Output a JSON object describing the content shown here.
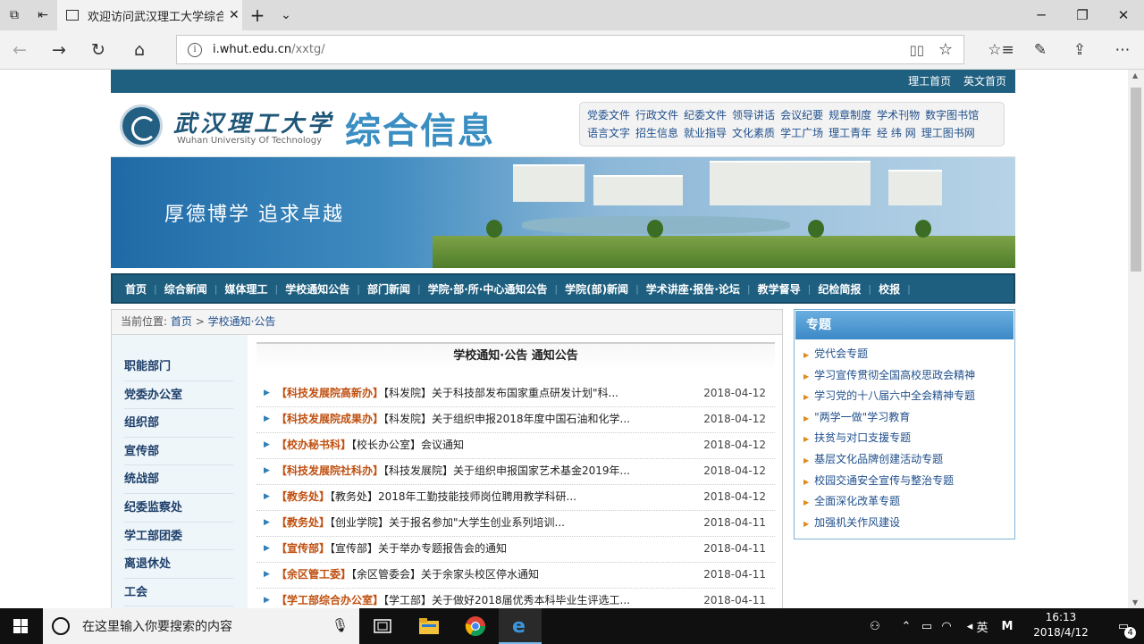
{
  "browser": {
    "tab_title": "欢迎访问武汉理工大学综合信息",
    "url_host": "i.whut.edu.cn",
    "url_path": "/xxtg/"
  },
  "site": {
    "top_links": [
      "理工首页",
      "英文首页"
    ],
    "logo_cn": "武汉理工大学",
    "logo_en": "Wuhan University Of Technology",
    "logo_title": "综合信息",
    "quick_links": [
      "党委文件",
      "行政文件",
      "纪委文件",
      "领导讲话",
      "会议纪要",
      "规章制度",
      "学术刊物",
      "数字图书馆",
      "语言文字",
      "招生信息",
      "就业指导",
      "文化素质",
      "学工广场",
      "理工青年",
      "经 纬 网",
      "理工图书网"
    ],
    "banner_slogan": "厚德博学  追求卓越",
    "nav": [
      "首页",
      "综合新闻",
      "媒体理工",
      "学校通知公告",
      "部门新闻",
      "学院·部·所·中心通知公告",
      "学院(部)新闻",
      "学术讲座·报告·论坛",
      "教学督导",
      "纪检简报",
      "校报"
    ],
    "breadcrumb_prefix": "当前位置:",
    "breadcrumb_home": "首页",
    "breadcrumb_sep": ">",
    "breadcrumb_current": "学校通知·公告",
    "side_nav": [
      "职能部门",
      "党委办公室",
      "组织部",
      "宣传部",
      "统战部",
      "纪委监察处",
      "学工部团委",
      "离退休处",
      "工会"
    ],
    "main_title": "学校通知·公告  通知公告",
    "news": [
      {
        "dept": "【科技发展院高新办】",
        "text": "【科发院】关于科技部发布国家重点研发计划\"科...",
        "date": "2018-04-12"
      },
      {
        "dept": "【科技发展院成果办】",
        "text": "【科发院】关于组织申报2018年度中国石油和化学...",
        "date": "2018-04-12"
      },
      {
        "dept": "【校办秘书科】",
        "text": "【校长办公室】会议通知",
        "date": "2018-04-12"
      },
      {
        "dept": "【科技发展院社科办】",
        "text": "【科技发展院】关于组织申报国家艺术基金2019年...",
        "date": "2018-04-12"
      },
      {
        "dept": "【教务处】",
        "text": "【教务处】2018年工勤技能技师岗位聘用教学科研...",
        "date": "2018-04-12"
      },
      {
        "dept": "【教务处】",
        "text": "【创业学院】关于报名参加\"大学生创业系列培训...",
        "date": "2018-04-11"
      },
      {
        "dept": "【宣传部】",
        "text": "【宣传部】关于举办专题报告会的通知",
        "date": "2018-04-11"
      },
      {
        "dept": "【余区管工委】",
        "text": "【余区管委会】关于余家头校区停水通知",
        "date": "2018-04-11"
      },
      {
        "dept": "【学工部综合办公室】",
        "text": "【学工部】关于做好2018届优秀本科毕业生评选工...",
        "date": "2018-04-11"
      }
    ],
    "special_title": "专题",
    "special_items": [
      "党代会专题",
      "学习宣传贯彻全国高校思政会精神",
      "学习党的十八届六中全会精神专题",
      "\"两学一做\"学习教育",
      "扶贫与对口支援专题",
      "基层文化品牌创建活动专题",
      "校园交通安全宣传与整治专题",
      "全面深化改革专题",
      "加强机关作风建设"
    ]
  },
  "taskbar": {
    "search_placeholder": "在这里输入你要搜索的内容",
    "ime": "英",
    "ime_mode": "M",
    "time": "16:13",
    "date": "2018/4/12",
    "notifications": "4"
  },
  "colors": {
    "nav_bg": "#1e5f80",
    "accent_blue": "#3a8ec2",
    "link": "#1f4f8c",
    "dept_orange": "#c05010"
  }
}
